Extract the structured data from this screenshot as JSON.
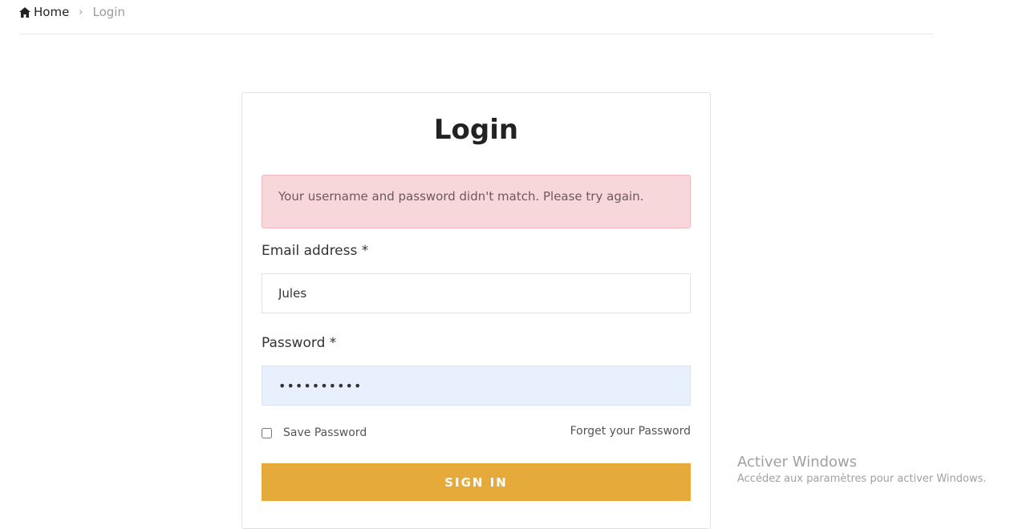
{
  "breadcrumb": {
    "home": "Home",
    "separator": "›",
    "current": "Login"
  },
  "login": {
    "title": "Login",
    "error": "Your username and password didn't match. Please try again.",
    "email_label": "Email address *",
    "email_value": "Jules",
    "password_label": "Password *",
    "password_value": "••••••••••",
    "save_password": "Save Password",
    "save_password_checked": false,
    "forgot": "Forget your Password",
    "submit": "SIGN IN"
  },
  "watermark": {
    "title": "Activer Windows",
    "subtitle": "Accédez aux paramètres pour activer Windows."
  },
  "colors": {
    "accent": "#e6aa3b",
    "alert_bg": "#f8d7da",
    "autofill_bg": "#e8f0fe"
  },
  "icons": {
    "home": "home-icon"
  }
}
